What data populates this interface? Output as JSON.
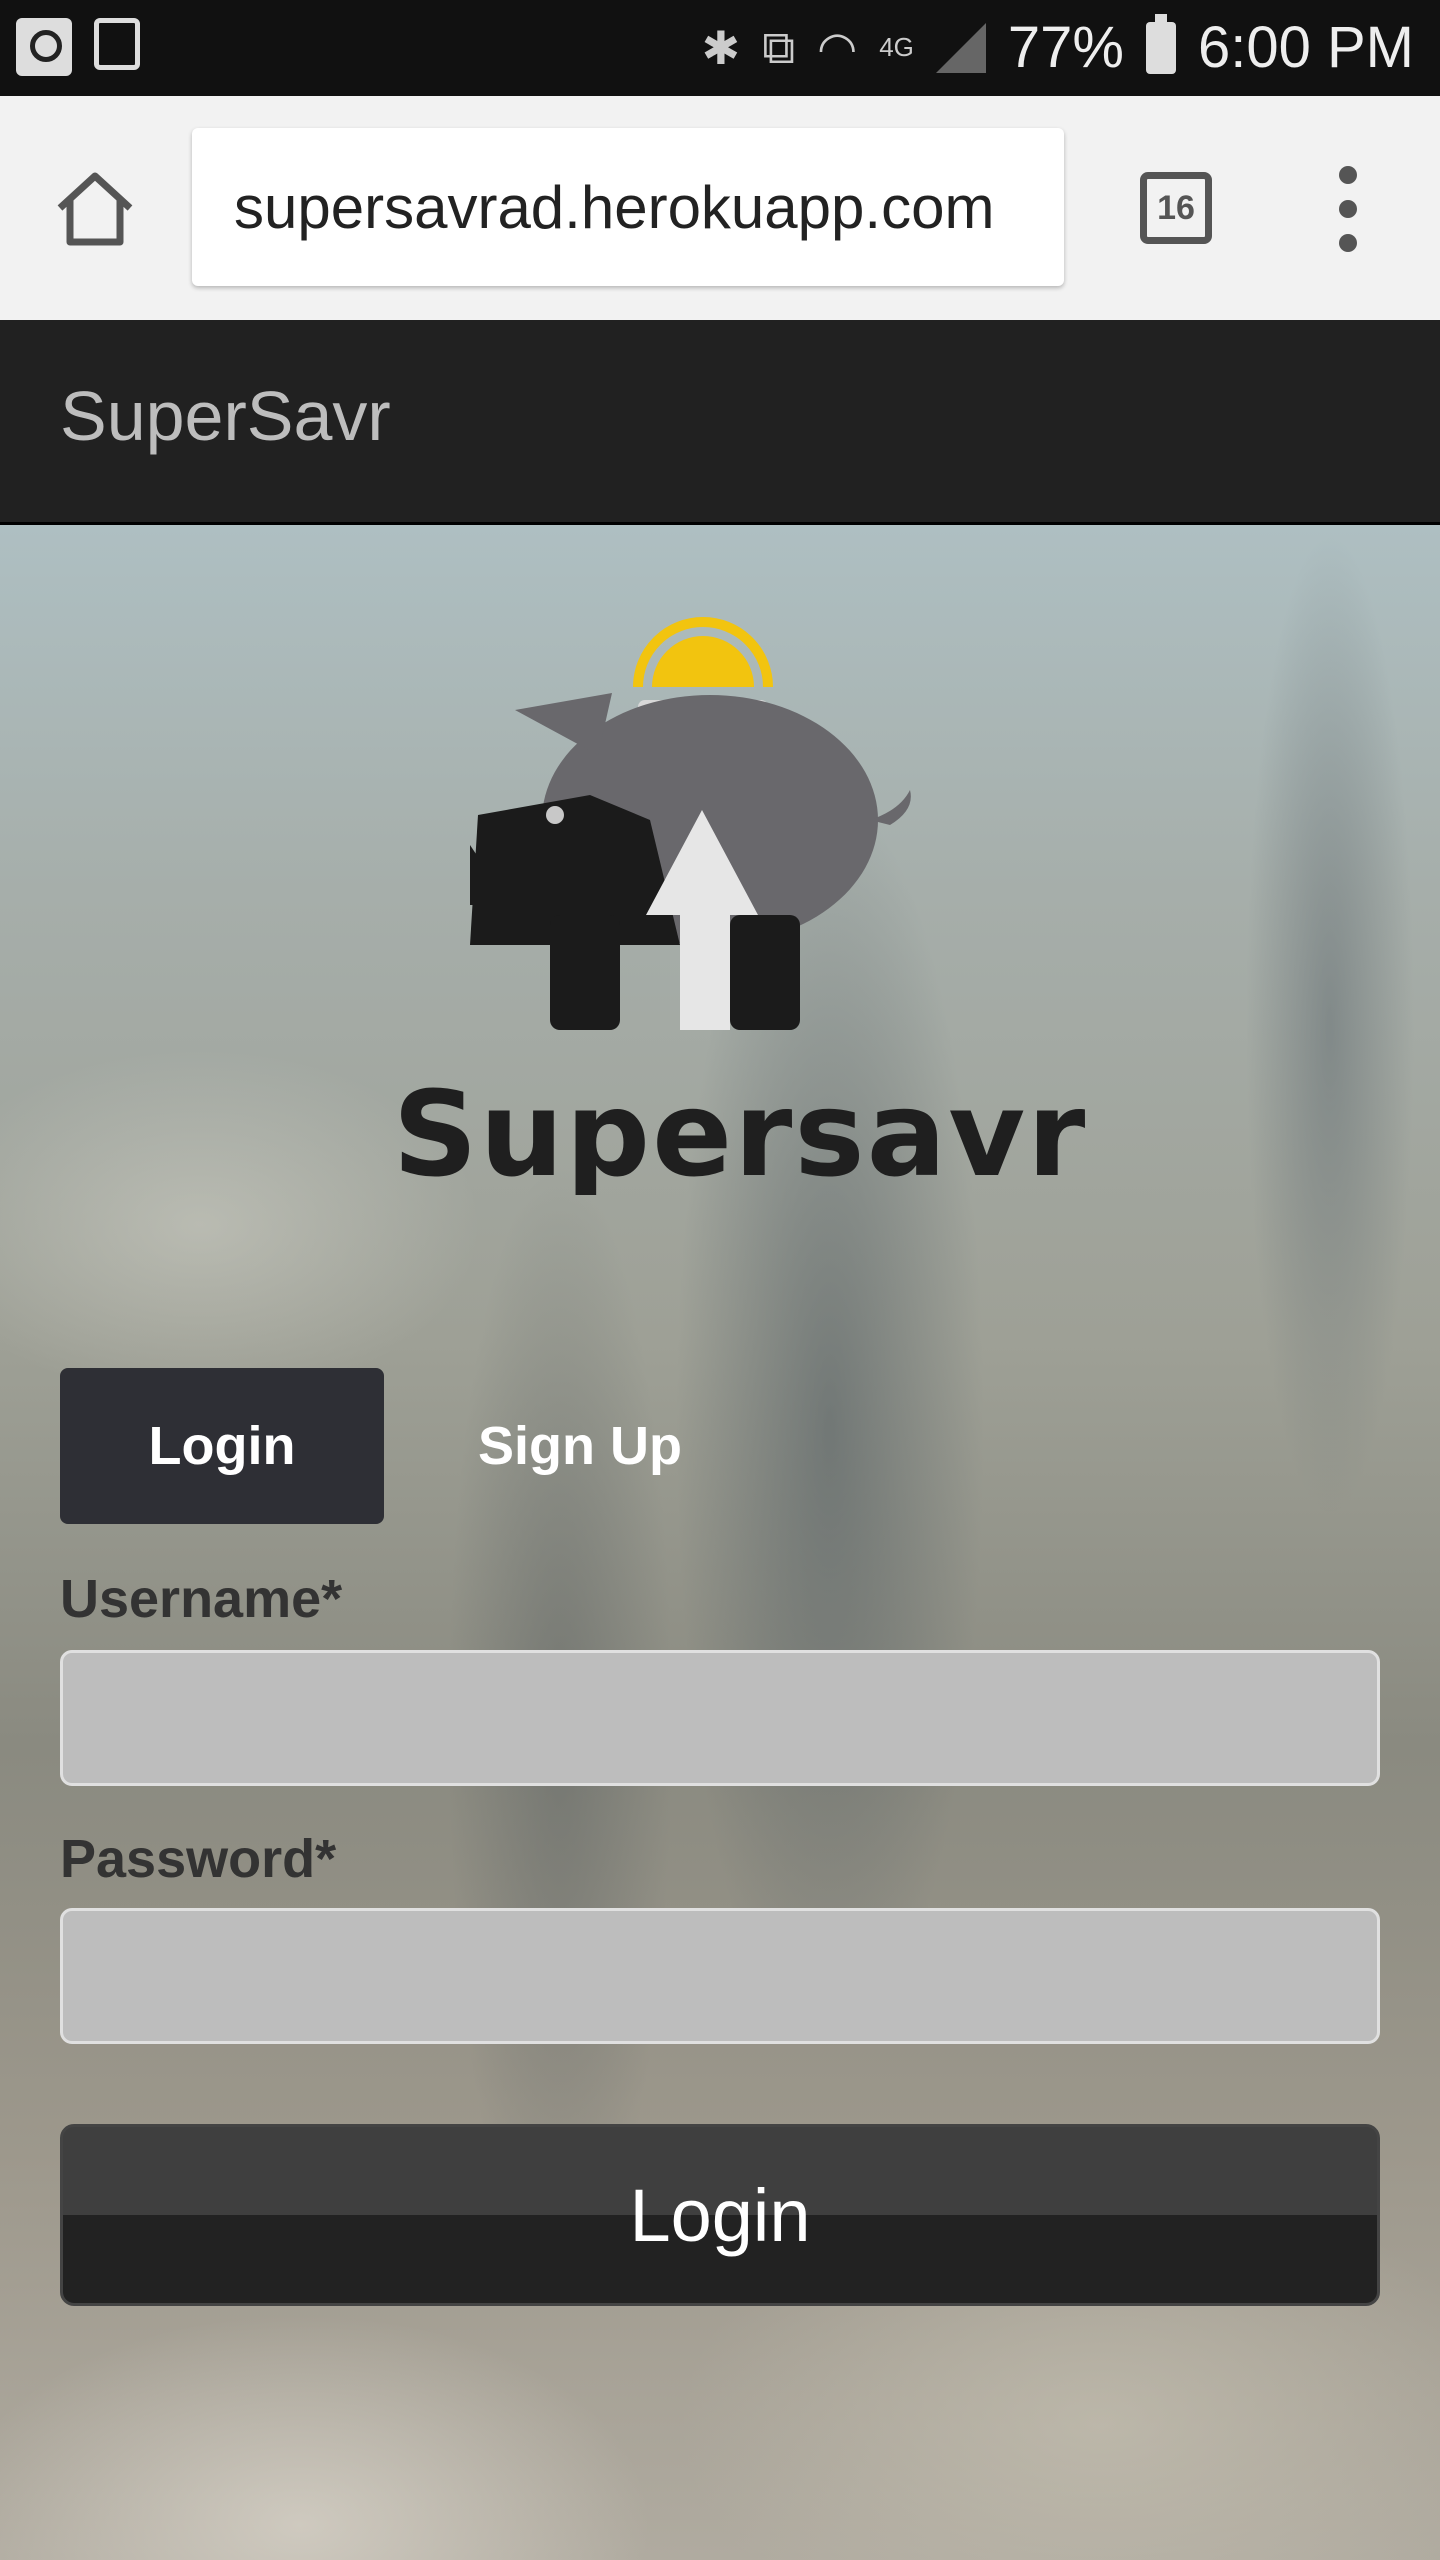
{
  "status_bar": {
    "battery": "77%",
    "time": "6:00 PM"
  },
  "browser": {
    "url": "supersavrad.herokuapp.com",
    "tab_count": "16"
  },
  "app": {
    "title": "SuperSavr"
  },
  "logo": {
    "wordmark": "Supersavr",
    "colors": {
      "pig": "#69686c",
      "coin": "#f2c40f",
      "dark": "#1b1b1b"
    }
  },
  "auth_tabs": {
    "login": "Login",
    "signup": "Sign Up",
    "active": "login"
  },
  "form": {
    "username_label": "Username*",
    "username_value": "",
    "password_label": "Password*",
    "password_value": "",
    "submit_label": "Login"
  }
}
